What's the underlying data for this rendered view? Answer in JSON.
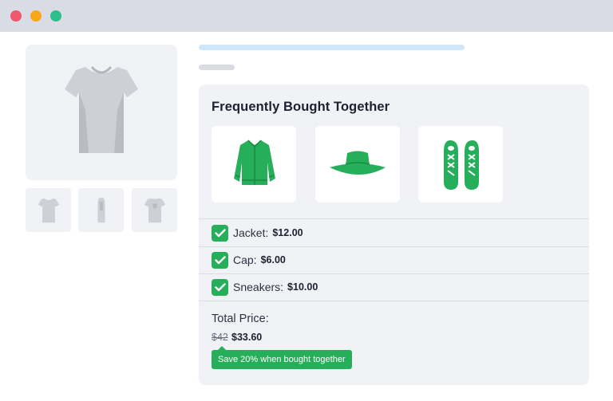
{
  "bundle": {
    "heading": "Frequently Bought Together",
    "products": [
      {
        "icon": "jacket-icon"
      },
      {
        "icon": "hat-icon"
      },
      {
        "icon": "sneakers-icon"
      }
    ],
    "items": [
      {
        "name": "Jacket:",
        "price": "$12.00",
        "checked": true
      },
      {
        "name": "Cap:",
        "price": "$6.00",
        "checked": true
      },
      {
        "name": "Sneakers:",
        "price": "$10.00",
        "checked": true
      }
    ],
    "total_label": "Total Price:",
    "old_price": "$42",
    "new_price": "$33.60",
    "badge": "Save 20% when bought together"
  },
  "gallery": {
    "main_icon": "tshirt-icon",
    "thumbnails": [
      "tshirt-front-icon",
      "tshirt-side-icon",
      "tshirt-back-icon"
    ]
  },
  "colors": {
    "accent": "#27ae5a",
    "card_bg": "#f1f2f6",
    "titlebar": "#d9dce5"
  }
}
